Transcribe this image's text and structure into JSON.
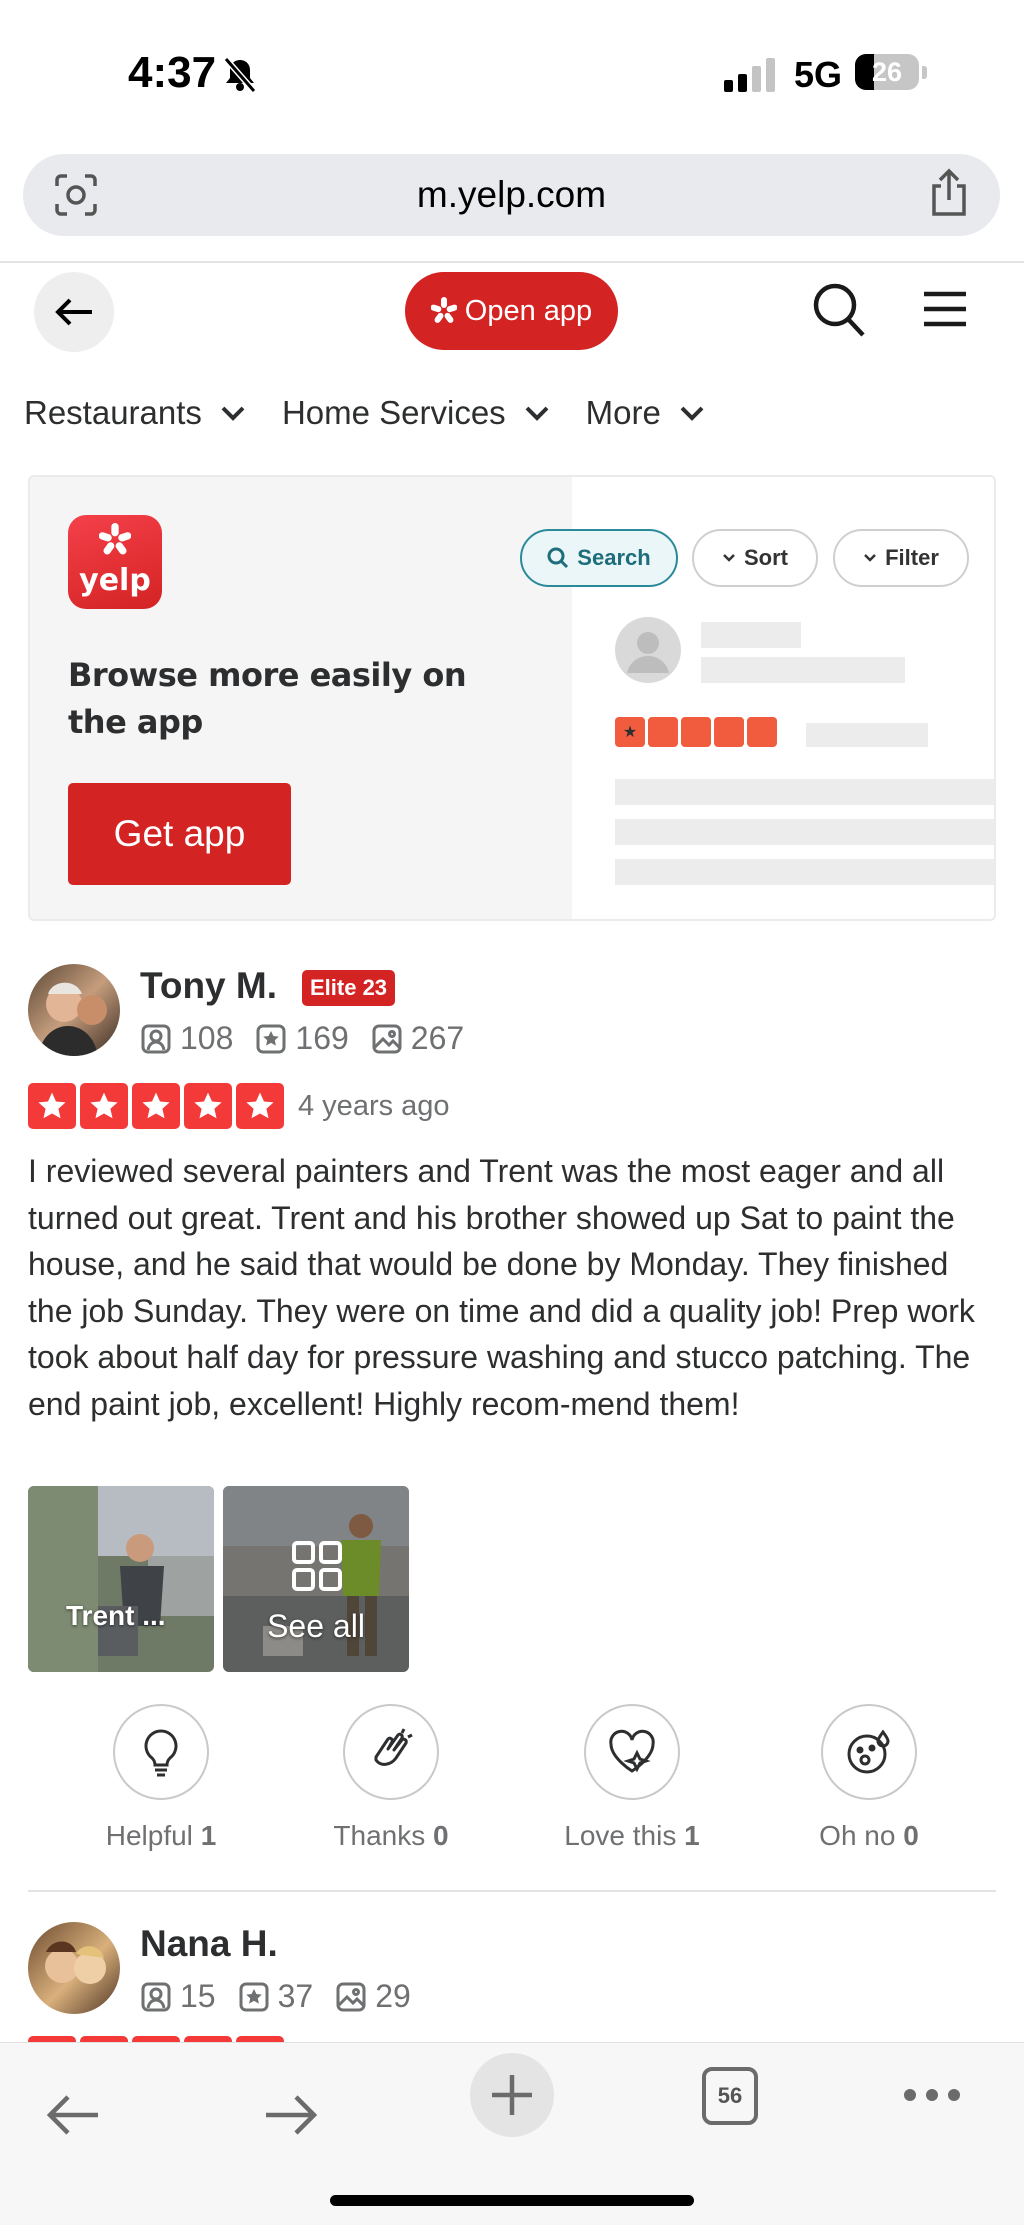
{
  "status_bar": {
    "time": "4:37",
    "network": "5G",
    "battery_level": "26"
  },
  "browser": {
    "url": "m.yelp.com",
    "open_tabs": "56"
  },
  "header": {
    "open_app_label": "Open app"
  },
  "nav": {
    "categories": [
      "Restaurants",
      "Home Services",
      "More"
    ]
  },
  "banner": {
    "logo_text": "yelp",
    "heading": "Browse more easily on the app",
    "cta": "Get app",
    "preview_search": "Search",
    "preview_sort": "Sort",
    "preview_filter": "Filter"
  },
  "reviews": [
    {
      "name": "Tony M.",
      "badge": "Elite 23",
      "friends": "108",
      "reviews": "169",
      "photos": "267",
      "rating": 5,
      "date": "4 years ago",
      "text": "I reviewed several painters and Trent was the most eager and all turned out great. Trent and his brother showed up Sat to paint the house, and he said that would be done by Monday. They finished the job Sunday. They were on time and did a quality job! Prep work took about half day for pressure washing and stucco patching. The end paint job, excellent! Highly recom-mend them!",
      "photo_caption": "Trent ...",
      "see_all": "See all",
      "reactions": [
        {
          "label": "Helpful",
          "count": "1",
          "icon": "lightbulb-icon"
        },
        {
          "label": "Thanks",
          "count": "0",
          "icon": "clapping-hands-icon"
        },
        {
          "label": "Love this",
          "count": "1",
          "icon": "heart-icon"
        },
        {
          "label": "Oh no",
          "count": "0",
          "icon": "surprised-face-icon"
        }
      ]
    },
    {
      "name": "Nana H.",
      "friends": "15",
      "reviews": "37",
      "photos": "29"
    }
  ],
  "colors": {
    "brand_red": "#d32323",
    "star_red": "#f43939",
    "teal": "#2b8a9a"
  }
}
